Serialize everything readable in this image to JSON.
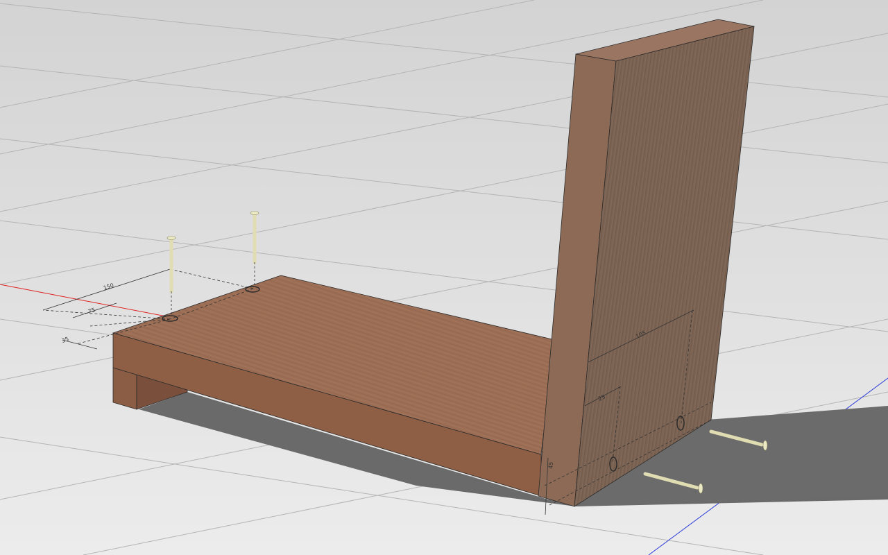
{
  "viewport": {
    "name": "3D model view",
    "background_top": "#d7d7d7",
    "background_bottom": "#ebebeb",
    "grid_color": "#b4b4b4",
    "axis_x_color": "#e12020",
    "axis_y_color": "#2c3bd9",
    "shadow_color": "#6a6a6a"
  },
  "model": {
    "wood_top": "#9a6d54",
    "wood_front": "#8e5f45",
    "wood_end": "#7c5240",
    "wood_upright_face": "#7b6353",
    "wood_upright_edge": "#8c6a55",
    "screw_color": "#e1ddb3"
  },
  "dimensions": {
    "horizontal_board": {
      "overall": "150",
      "inner": "75",
      "edge": "35"
    },
    "vertical_board": {
      "overall": "105",
      "inner": "25",
      "edge": "45"
    }
  }
}
